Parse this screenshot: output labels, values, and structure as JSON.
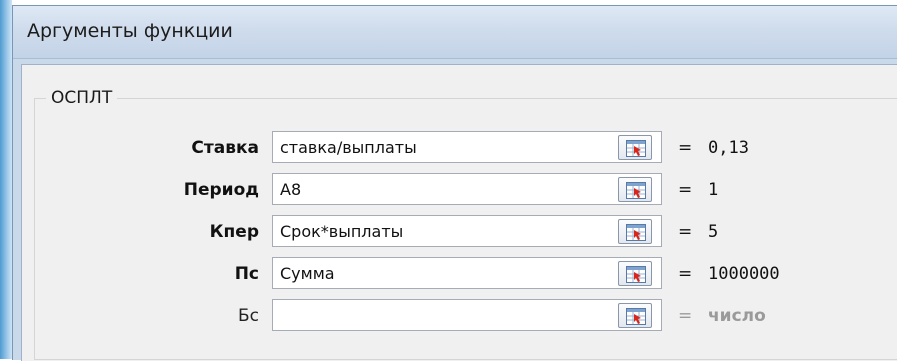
{
  "dialog": {
    "title": "Аргументы функции"
  },
  "function": {
    "name": "ОСПЛТ"
  },
  "arguments": [
    {
      "label": "Ставка",
      "value": "ставка/выплаты",
      "result": "0,13",
      "required": true
    },
    {
      "label": "Период",
      "value": "А8",
      "result": "1",
      "required": true
    },
    {
      "label": "Кпер",
      "value": "Срок*выплаты",
      "result": "5",
      "required": true
    },
    {
      "label": "Пс",
      "value": "Сумма",
      "result": "1000000",
      "required": true
    },
    {
      "label": "Бс",
      "value": "",
      "result": "число",
      "required": false
    }
  ],
  "equals_sign": "=",
  "icons": {
    "ref_button": "collapse-dialog-icon"
  },
  "colors": {
    "hint_text": "#9a9a9a",
    "title_bar": "#cfdcec"
  }
}
